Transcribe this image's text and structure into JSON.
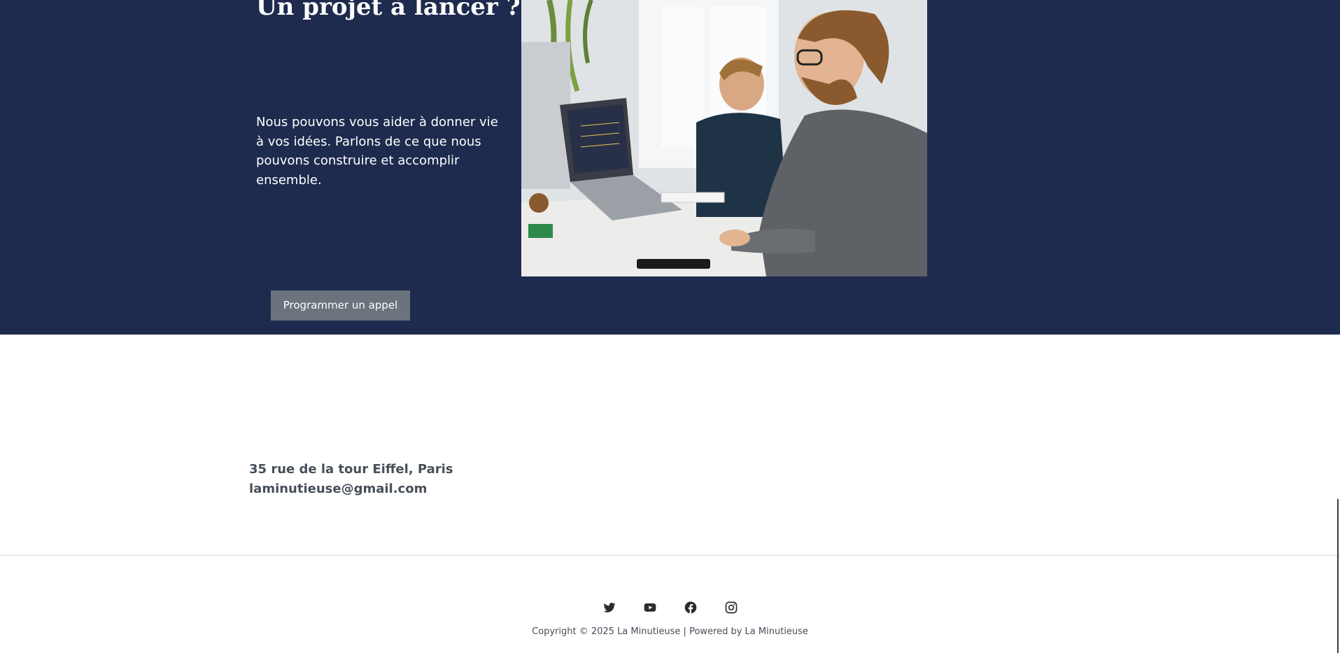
{
  "hero": {
    "title": "Un projet à lancer ?",
    "text": "Nous pouvons vous aider à donner vie à vos idées. Parlons de ce que nous pouvons construire et accomplir ensemble.",
    "photo_icon": "office-workers-photo",
    "cta_label": "Programmer un appel",
    "background_color": "#1e2b4e",
    "button_color": "#6b737c"
  },
  "contact": {
    "address": "35 rue de la tour Eiffel, Paris",
    "email": "laminutieuse@gmail.com"
  },
  "footer": {
    "socials": [
      {
        "icon": "twitter-icon"
      },
      {
        "icon": "youtube-icon"
      },
      {
        "icon": "facebook-icon"
      },
      {
        "icon": "instagram-icon"
      }
    ],
    "copyright": "Copyright © 2025 La Minutieuse | Powered by La Minutieuse"
  }
}
